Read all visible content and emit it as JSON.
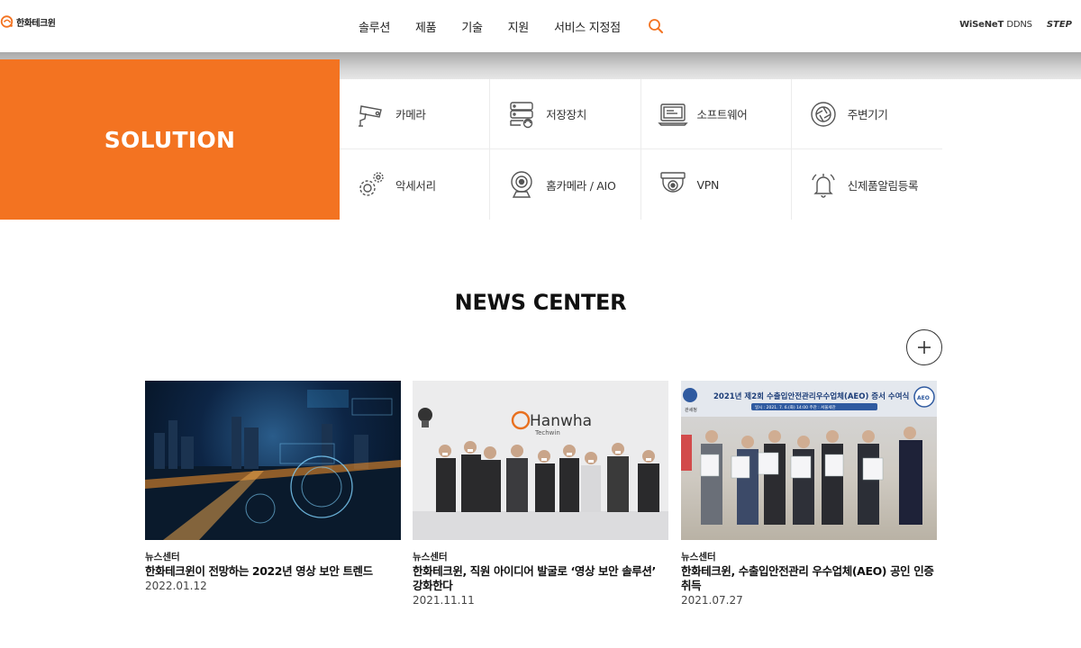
{
  "header": {
    "logo_text": "한화테크윈",
    "nav": [
      "솔루션",
      "제품",
      "기술",
      "지원",
      "서비스 지정점"
    ],
    "brand_wisenet_bold": "WiSeNeT",
    "brand_wisenet_rest": "DDNS",
    "brand_step": "STEP"
  },
  "solution": {
    "title": "SOLUTION",
    "items": [
      {
        "label": "카메라",
        "icon": "cctv-camera-icon"
      },
      {
        "label": "저장장치",
        "icon": "storage-server-icon"
      },
      {
        "label": "소프트웨어",
        "icon": "software-monitor-icon"
      },
      {
        "label": "주변기기",
        "icon": "lens-peripheral-icon"
      },
      {
        "label": "악세서리",
        "icon": "gears-icon"
      },
      {
        "label": "홈카메라 / AIO",
        "icon": "webcam-icon"
      },
      {
        "label": "VPN",
        "icon": "dome-camera-icon"
      },
      {
        "label": "신제품알림등록",
        "icon": "bell-icon"
      }
    ]
  },
  "news": {
    "title": "NEWS CENTER",
    "image_text": {
      "hanwha": "Hanwha",
      "techwin": "Techwin",
      "award_banner": "2021년 제2회 수출입안전관리우수업체(AEO) 증서 수여식",
      "award_sub": "일시 : 2021. 7. 6.(화) 14:00    주관 : 서울세관",
      "customs": "관세청",
      "aeo": "AEO"
    },
    "items": [
      {
        "category": "뉴스센터",
        "title": "한화테크윈이 전망하는 2022년 영상 보안 트렌드",
        "date": "2022.01.12"
      },
      {
        "category": "뉴스센터",
        "title": "한화테크윈, 직원 아이디어 발굴로 ‘영상 보안 솔루션’ 강화한다",
        "date": "2021.11.11"
      },
      {
        "category": "뉴스센터",
        "title": "한화테크윈, 수출입안전관리 우수업체(AEO) 공인 인증 취득",
        "date": "2021.07.27"
      }
    ]
  },
  "colors": {
    "accent": "#f37321",
    "text": "#222222"
  }
}
